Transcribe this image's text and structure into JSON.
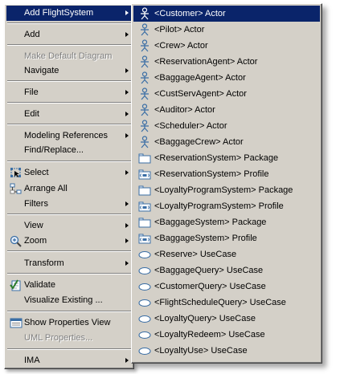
{
  "context_menu": {
    "items": [
      {
        "label": "Add FlightSystem",
        "submenu": true,
        "active": true
      },
      {
        "label": "Add",
        "submenu": true
      },
      {
        "label": "Make Default Diagram",
        "disabled": true
      },
      {
        "label": "Navigate",
        "submenu": true
      },
      {
        "label": "File",
        "submenu": true
      },
      {
        "label": "Edit",
        "submenu": true
      },
      {
        "label": "Modeling References",
        "submenu": true
      },
      {
        "label": "Find/Replace..."
      },
      {
        "label": "Select",
        "submenu": true,
        "icon": "select-icon"
      },
      {
        "label": "Arrange All",
        "icon": "arrange-all-icon"
      },
      {
        "label": "Filters",
        "submenu": true
      },
      {
        "label": "View",
        "submenu": true
      },
      {
        "label": "Zoom",
        "submenu": true,
        "icon": "zoom-icon"
      },
      {
        "label": "Transform",
        "submenu": true
      },
      {
        "label": "Validate",
        "icon": "validate-icon"
      },
      {
        "label": "Visualize Existing ..."
      },
      {
        "label": "Show Properties View",
        "icon": "properties-view-icon"
      },
      {
        "label": "UML Properties...",
        "disabled": true
      },
      {
        "label": "IMA",
        "submenu": true
      }
    ]
  },
  "submenu": {
    "items": [
      {
        "label": "<Customer> Actor",
        "icon": "actor-icon",
        "active": true
      },
      {
        "label": "<Pilot> Actor",
        "icon": "actor-icon"
      },
      {
        "label": "<Crew> Actor",
        "icon": "actor-icon"
      },
      {
        "label": "<ReservationAgent> Actor",
        "icon": "actor-icon"
      },
      {
        "label": "<BaggageAgent> Actor",
        "icon": "actor-icon"
      },
      {
        "label": "<CustServAgent> Actor",
        "icon": "actor-icon"
      },
      {
        "label": "<Auditor> Actor",
        "icon": "actor-icon"
      },
      {
        "label": "<Scheduler> Actor",
        "icon": "actor-icon"
      },
      {
        "label": "<BaggageCrew> Actor",
        "icon": "actor-icon"
      },
      {
        "label": "<ReservationSystem> Package",
        "icon": "package-icon"
      },
      {
        "label": "<ReservationSystem> Profile",
        "icon": "profile-icon"
      },
      {
        "label": "<LoyaltyProgramSystem> Package",
        "icon": "package-icon"
      },
      {
        "label": "<LoyaltyProgramSystem> Profile",
        "icon": "profile-icon"
      },
      {
        "label": "<BaggageSystem> Package",
        "icon": "package-icon"
      },
      {
        "label": "<BaggageSystem> Profile",
        "icon": "profile-icon"
      },
      {
        "label": "<Reserve> UseCase",
        "icon": "usecase-icon"
      },
      {
        "label": "<BaggageQuery> UseCase",
        "icon": "usecase-icon"
      },
      {
        "label": "<CustomerQuery> UseCase",
        "icon": "usecase-icon"
      },
      {
        "label": "<FlightScheduleQuery> UseCase",
        "icon": "usecase-icon"
      },
      {
        "label": "<LoyaltyQuery> UseCase",
        "icon": "usecase-icon"
      },
      {
        "label": "<LoyaltyRedeem> UseCase",
        "icon": "usecase-icon"
      },
      {
        "label": "<LoyaltyUse> UseCase",
        "icon": "usecase-icon"
      }
    ]
  },
  "colors": {
    "menu_background": "#d4d0c8",
    "highlight": "#0a246a",
    "highlight_text": "#ffffff",
    "disabled_text": "#808080",
    "icon_blue": "#3a6ea5"
  }
}
